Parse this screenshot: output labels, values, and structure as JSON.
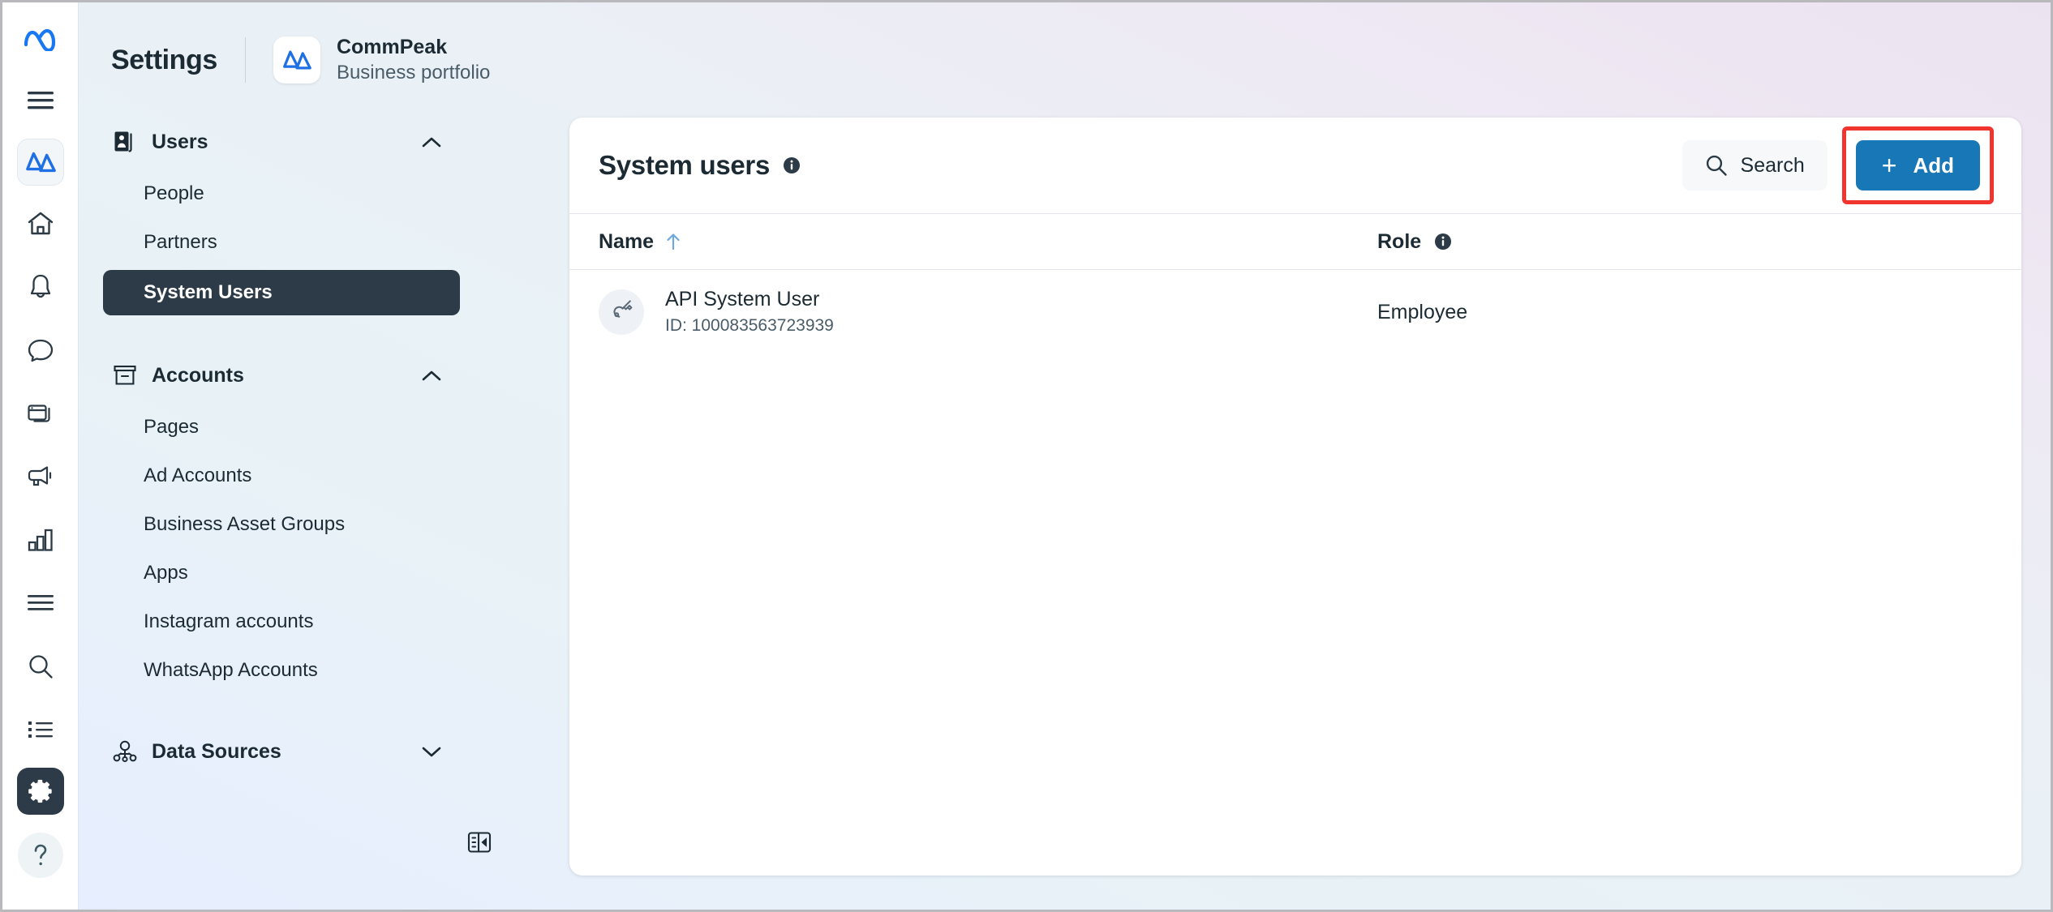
{
  "window": {
    "background_top_right": "#ece3f0",
    "background_bottom_left": "#e7eeff"
  },
  "icon_rail": {
    "items": [
      {
        "name": "meta-logo-icon",
        "label": "Meta"
      },
      {
        "name": "hamburger-menu-icon",
        "label": "Menu"
      },
      {
        "name": "commpeak-brand-icon",
        "label": "CommPeak"
      },
      {
        "name": "home-icon",
        "label": "Home"
      },
      {
        "name": "bell-icon",
        "label": "Notifications"
      },
      {
        "name": "chat-bubble-icon",
        "label": "Messages"
      },
      {
        "name": "windows-icon",
        "label": "Pages"
      },
      {
        "name": "megaphone-icon",
        "label": "Ads"
      },
      {
        "name": "bar-chart-icon",
        "label": "Insights"
      },
      {
        "name": "list-lines-icon",
        "label": "Feed"
      },
      {
        "name": "search-icon",
        "label": "Search"
      },
      {
        "name": "bullet-list-icon",
        "label": "Library"
      },
      {
        "name": "gear-icon",
        "label": "Settings"
      },
      {
        "name": "help-question-icon",
        "label": "Help"
      }
    ]
  },
  "topbar": {
    "settings_label": "Settings",
    "brand_name": "CommPeak",
    "brand_subtitle": "Business portfolio"
  },
  "sidebar": {
    "groups": [
      {
        "label": "Users",
        "icon": "users-badge-icon",
        "expanded": true,
        "chevron": "chevron-up-icon",
        "items": [
          {
            "label": "People",
            "selected": false
          },
          {
            "label": "Partners",
            "selected": false
          },
          {
            "label": "System Users",
            "selected": true
          }
        ]
      },
      {
        "label": "Accounts",
        "icon": "archive-box-icon",
        "expanded": true,
        "chevron": "chevron-up-icon",
        "items": [
          {
            "label": "Pages",
            "selected": false
          },
          {
            "label": "Ad Accounts",
            "selected": false
          },
          {
            "label": "Business Asset Groups",
            "selected": false
          },
          {
            "label": "Apps",
            "selected": false
          },
          {
            "label": "Instagram accounts",
            "selected": false
          },
          {
            "label": "WhatsApp Accounts",
            "selected": false
          }
        ]
      },
      {
        "label": "Data Sources",
        "icon": "data-sources-nodes-icon",
        "expanded": false,
        "chevron": "chevron-down-icon",
        "items": []
      }
    ],
    "collapse_panel_icon": "collapse-sidebar-icon"
  },
  "main": {
    "title": "System users",
    "title_info_icon": "info-icon",
    "search_label": "Search",
    "search_icon": "search-icon",
    "add_label": "Add",
    "add_plus": "+",
    "add_highlight_color": "#f0352f",
    "add_button_color": "#1877b6",
    "table": {
      "columns": [
        {
          "key": "name",
          "label": "Name",
          "sorted": true,
          "sort_icon": "arrow-up-icon",
          "info": false
        },
        {
          "key": "role",
          "label": "Role",
          "sorted": false,
          "info": true,
          "info_icon": "info-icon"
        }
      ],
      "rows": [
        {
          "avatar_icon": "key-icon",
          "name": "API System User",
          "id": "ID: 100083563723939",
          "role": "Employee"
        }
      ]
    }
  }
}
